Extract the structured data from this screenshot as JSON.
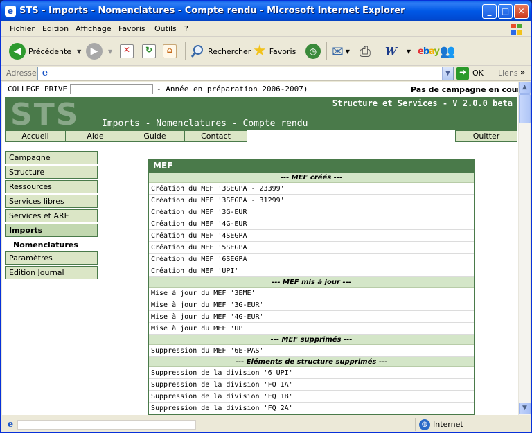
{
  "window": {
    "title": "STS - Imports - Nomenclatures - Compte rendu - Microsoft Internet Explorer",
    "minimize": "_",
    "maximize": "□",
    "close": "✕"
  },
  "menubar": {
    "items": [
      "Fichier",
      "Edition",
      "Affichage",
      "Favoris",
      "Outils",
      "?"
    ]
  },
  "toolbar": {
    "back_label": "Précédente",
    "search_label": "Rechercher",
    "favorites_label": "Favoris",
    "back_icon": "back-arrow-icon",
    "forward_icon": "forward-arrow-icon",
    "stop_icon": "stop-icon",
    "refresh_icon": "refresh-icon",
    "home_icon": "home-icon"
  },
  "addressbar": {
    "label": "Adresse",
    "value": "",
    "go_label": "OK",
    "links_label": "Liens"
  },
  "page": {
    "school": "COLLEGE PRIVE",
    "school_input": "",
    "year_text": "- Année en préparation 2006-2007)",
    "campaign_status": "Pas de campagne en cours",
    "logo": "STS",
    "version": "Structure et Services - V 2.0.0 beta",
    "page_title": "Imports - Nomenclatures - Compte rendu"
  },
  "topnav": {
    "items": [
      "Accueil",
      "Aide",
      "Guide",
      "Contact"
    ],
    "quit": "Quitter"
  },
  "sidenav": {
    "items": [
      "Campagne",
      "Structure",
      "Ressources",
      "Services libres",
      "Services et ARE",
      "Imports",
      "Paramètres",
      "Edition Journal"
    ],
    "sub_item": "Nomenclatures"
  },
  "mef": {
    "header": "MEF",
    "sections": [
      {
        "title": "--- MEF créés ---",
        "rows": [
          "Création du MEF '3SEGPA - 23399'",
          "Création du MEF '3SEGPA - 31299'",
          "Création du MEF '3G-EUR'",
          "Création du MEF '4G-EUR'",
          "Création du MEF '4SEGPA'",
          "Création du MEF '5SEGPA'",
          "Création du MEF '6SEGPA'",
          "Création du MEF 'UPI'"
        ]
      },
      {
        "title": "--- MEF mis à jour ---",
        "rows": [
          "Mise à jour du MEF '3EME'",
          "Mise à jour du MEF '3G-EUR'",
          "Mise à jour du MEF '4G-EUR'",
          "Mise à jour du MEF 'UPI'"
        ]
      },
      {
        "title": "--- MEF supprimés ---",
        "rows": [
          "Suppression du MEF '6E-PAS'"
        ]
      },
      {
        "title": "--- Eléments de structure supprimés ---",
        "rows": [
          "Suppression de la division '6 UPI'",
          "Suppression de la division 'FQ 1A'",
          "Suppression de la division 'FQ 1B'",
          "Suppression de la division 'FQ 2A'"
        ]
      }
    ]
  },
  "statusbar": {
    "zone": "Internet"
  }
}
